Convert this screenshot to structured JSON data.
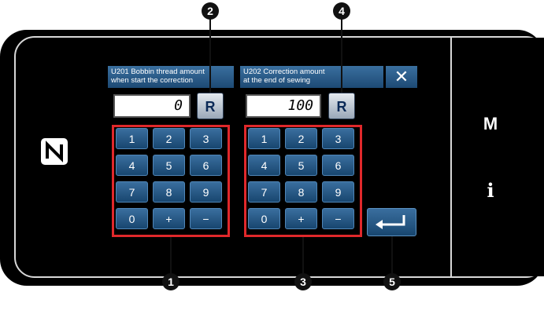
{
  "header": {
    "field1_line1": "U201 Bobbin thread amount",
    "field1_line2": "when start the correction",
    "field2_line1": "U202 Correction amount",
    "field2_line2": "at the end of sewing",
    "close_symbol": "✕"
  },
  "displays": {
    "value1": "0",
    "value2": "100"
  },
  "reset_label": "R",
  "keypad1": [
    "1",
    "2",
    "3",
    "4",
    "5",
    "6",
    "7",
    "8",
    "9",
    "0",
    "+",
    "−"
  ],
  "keypad2": [
    "1",
    "2",
    "3",
    "4",
    "5",
    "6",
    "7",
    "8",
    "9",
    "0",
    "+",
    "−"
  ],
  "side": {
    "m_label": "M",
    "i_label": "i"
  },
  "markers": [
    "1",
    "2",
    "3",
    "4",
    "5"
  ],
  "icons": {
    "nfc": "nfc-icon",
    "enter": "enter-icon",
    "close": "close-icon"
  },
  "colors": {
    "accent": "#e0282b",
    "key": "#2a5b8a",
    "frame": "#000000"
  }
}
